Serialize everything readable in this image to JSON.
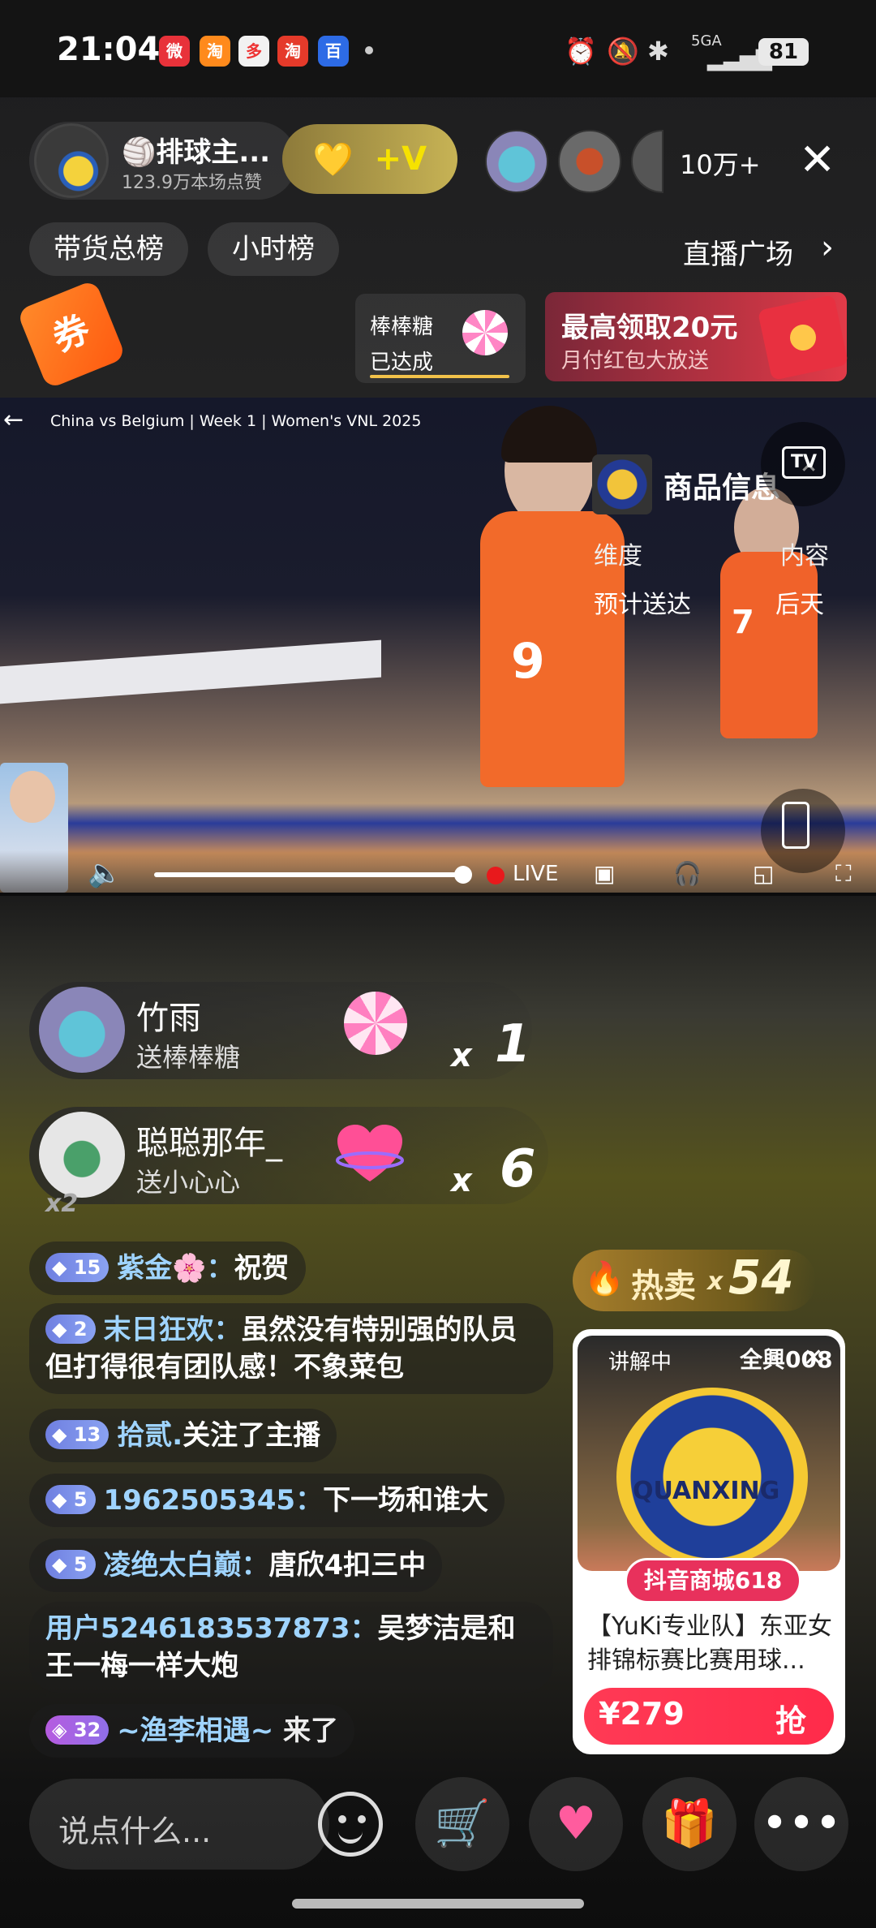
{
  "status_bar": {
    "time": "21:04",
    "apps": [
      "微",
      "淘",
      "多",
      "淘",
      "百"
    ],
    "network": "5GA",
    "battery": "81"
  },
  "host": {
    "name": "🏐排球主...",
    "likes": "123.9万本场点赞",
    "vbadge": "+V"
  },
  "viewers": {
    "count": "10万+"
  },
  "rank_tabs": [
    "带货总榜",
    "小时榜"
  ],
  "plaza": {
    "label": "直播广场"
  },
  "coupon": {
    "label": "券"
  },
  "gift_task": {
    "title": "棒棒糖",
    "status": "已达成"
  },
  "redpack": {
    "title": "最高领取20元",
    "subtitle": "月付红包大放送"
  },
  "video": {
    "title": "China vs Belgium | Week 1 | Women's VNL 2025",
    "jersey_1": "9",
    "jersey_2": "7",
    "live_label": "LIVE"
  },
  "product_info": {
    "title": "商品信息",
    "rows": [
      {
        "key": "维度",
        "value": "内容"
      },
      {
        "key": "预计送达",
        "value": "后天"
      }
    ]
  },
  "gifts": [
    {
      "user": "竹雨",
      "action": "送棒棒糖",
      "x": "x",
      "count": "1"
    },
    {
      "user": "聪聪那年_",
      "action": "送小心心",
      "x": "x",
      "count": "6"
    }
  ],
  "gift_combo": "x2",
  "chat": [
    {
      "level": "15",
      "user": "紫金🌸：",
      "msg": "祝贺"
    },
    {
      "level": "2",
      "user": "末日狂欢：",
      "msg": "虽然没有特别强的队员但打得很有团队感！不象菜包"
    },
    {
      "level": "13",
      "user": "拾贰.",
      "msg": "关注了主播"
    },
    {
      "level": "5",
      "user": "1962505345：",
      "msg": "下一场和谁大"
    },
    {
      "level": "5",
      "user": "凌绝太白巅：",
      "msg": "唐欣4扣三中"
    },
    {
      "level": "",
      "user": "用户5246183537873：",
      "msg": "吴梦洁是和王一梅一样大炮"
    },
    {
      "level": "32",
      "user": "~渔李相遇~",
      "msg": "来了"
    }
  ],
  "hot_sale": {
    "label": "热卖",
    "x": "x",
    "count": "54"
  },
  "product_card": {
    "tag": "讲解中",
    "model": "全興008",
    "brand": "QUANXING",
    "banner": "抖音商城618",
    "desc": "【YuKi专业队】东亚女排锦标赛比赛用球...",
    "price": "¥279",
    "buy_label": "抢"
  },
  "bottom_bar": {
    "placeholder": "说点什么..."
  },
  "colors": {
    "accent": "#ff2b4a",
    "username": "#9fd4ff",
    "live": "#e8191c"
  }
}
